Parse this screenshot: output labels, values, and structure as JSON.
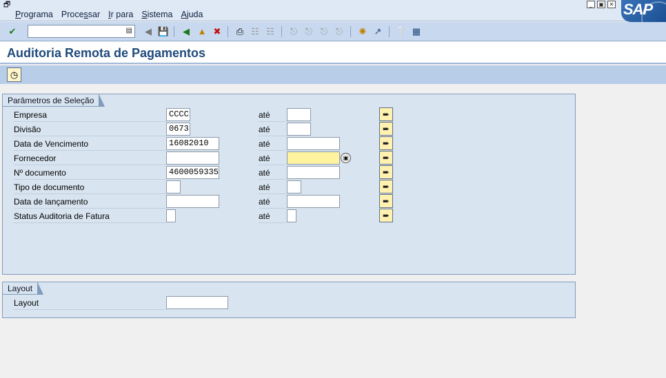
{
  "menubar": {
    "items": [
      {
        "pre": "",
        "acc": "P",
        "post": "rograma"
      },
      {
        "pre": "Proce",
        "acc": "s",
        "post": "sar"
      },
      {
        "pre": "",
        "acc": "I",
        "post": "r para"
      },
      {
        "pre": "",
        "acc": "S",
        "post": "istema"
      },
      {
        "pre": "",
        "acc": "A",
        "post": "juda"
      }
    ],
    "logo": "SAP"
  },
  "toolbar": {
    "command_value": ""
  },
  "title": "Auditoria Remota de Pagamentos",
  "selection": {
    "group_title": "Parâmetros de Seleção",
    "to_label": "até",
    "rows": [
      {
        "label": "Empresa",
        "from": "CCCC",
        "to": ""
      },
      {
        "label": "Divisão",
        "from": "0673",
        "to": ""
      },
      {
        "label": "Data de Vencimento",
        "from": "16082010",
        "to": ""
      },
      {
        "label": "Fornecedor",
        "from": "",
        "to": ""
      },
      {
        "label": "Nº documento",
        "from": "4600059335",
        "to": ""
      },
      {
        "label": "Tipo de documento",
        "from": "",
        "to": ""
      },
      {
        "label": "Data de lançamento",
        "from": "",
        "to": ""
      },
      {
        "label": "Status Auditoria de Fatura",
        "from": "",
        "to": ""
      }
    ]
  },
  "layout_group": {
    "group_title": "Layout",
    "label": "Layout",
    "value": ""
  },
  "colors": {
    "title": "#1f4a7c",
    "focused_field": "#fff3a0",
    "group_bg": "#d8e4ef"
  }
}
